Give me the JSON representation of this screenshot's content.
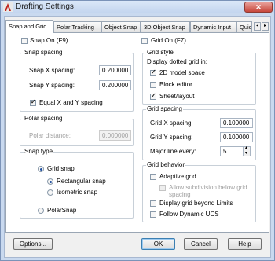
{
  "window": {
    "title": "Drafting Settings",
    "close_glyph": "✕"
  },
  "tabs": [
    "Snap and Grid",
    "Polar Tracking",
    "Object Snap",
    "3D Object Snap",
    "Dynamic Input",
    "Quic"
  ],
  "tab_scroll": {
    "left": "◂",
    "right": "▸"
  },
  "snap_on": {
    "label": "Snap On (F9)",
    "checked": false
  },
  "snap_spacing": {
    "title": "Snap spacing",
    "x_label": "Snap X spacing:",
    "x_value": "0.200000",
    "y_label": "Snap Y spacing:",
    "y_value": "0.200000",
    "equal_label": "Equal X and Y spacing",
    "equal_checked": true
  },
  "polar_spacing": {
    "title": "Polar spacing",
    "distance_label": "Polar distance:",
    "distance_value": "0.000000"
  },
  "snap_type": {
    "title": "Snap type",
    "grid_snap": "Grid snap",
    "rectangular": "Rectangular snap",
    "isometric": "Isometric snap",
    "polar": "PolarSnap"
  },
  "grid_on": {
    "label": "Grid On (F7)",
    "checked": false
  },
  "grid_style": {
    "title": "Grid style",
    "subtitle": "Display dotted grid in:",
    "model_space": "2D model space",
    "block_editor": "Block editor",
    "sheet_layout": "Sheet/layout"
  },
  "grid_spacing": {
    "title": "Grid spacing",
    "x_label": "Grid X spacing:",
    "x_value": "0.100000",
    "y_label": "Grid Y spacing:",
    "y_value": "0.100000",
    "major_label": "Major line every:",
    "major_value": "5"
  },
  "grid_behavior": {
    "title": "Grid behavior",
    "adaptive": "Adaptive grid",
    "subdivision_line1": "Allow subdivision below grid",
    "subdivision_line2": "spacing",
    "beyond_limits": "Display grid beyond Limits",
    "follow_ucs": "Follow Dynamic UCS"
  },
  "buttons": {
    "options": "Options...",
    "ok": "OK",
    "cancel": "Cancel",
    "help": "Help"
  },
  "colors": {
    "title_bar": "#c9d9ef",
    "close_button": "#c7463b",
    "dialog": "#f0f0f0",
    "default_button_border": "#3c7fb1"
  }
}
